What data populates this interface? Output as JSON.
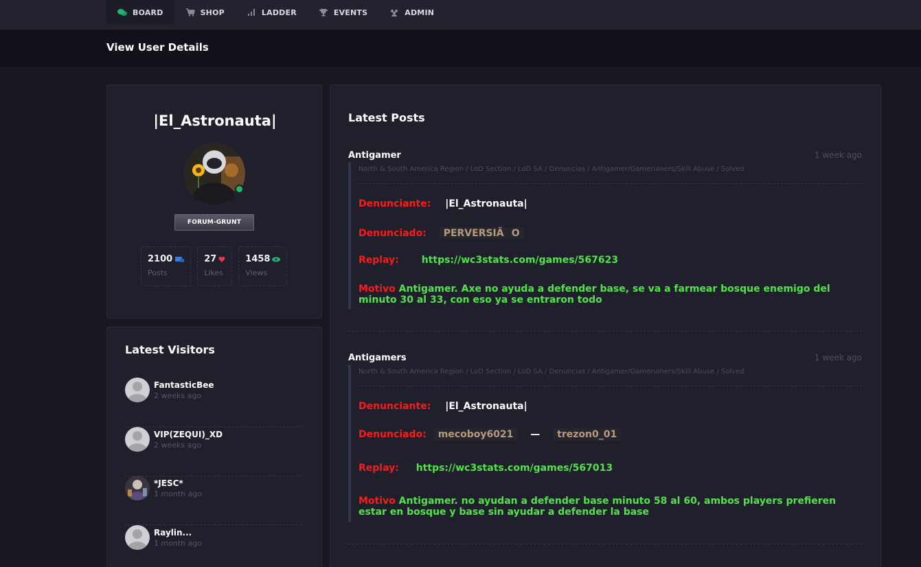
{
  "nav": {
    "items": [
      {
        "label": "BOARD",
        "icon": "chat-bubbles-icon"
      },
      {
        "label": "SHOP",
        "icon": "cart-icon"
      },
      {
        "label": "LADDER",
        "icon": "bar-chart-icon"
      },
      {
        "label": "EVENTS",
        "icon": "trophy-icon"
      },
      {
        "label": "ADMIN",
        "icon": "users-icon"
      }
    ]
  },
  "page": {
    "title": "View User Details"
  },
  "profile": {
    "username": "|El_Astronauta|",
    "rank": "FORUM-GRUNT",
    "stats": [
      {
        "value": "2100",
        "label": "Posts",
        "icon": "scroll-icon",
        "color": "#3d7bd9"
      },
      {
        "value": "27",
        "label": "Likes",
        "icon": "heart-icon",
        "color": "#e8394d"
      },
      {
        "value": "1458",
        "label": "Views",
        "icon": "eye-icon",
        "color": "#1fb86a"
      }
    ]
  },
  "visitors": {
    "title": "Latest Visitors",
    "items": [
      {
        "name": "FantasticBee",
        "time": "2 weeks ago"
      },
      {
        "name": "VIP(ZEQUI)_XD",
        "time": "2 weeks ago"
      },
      {
        "name": "*JESC*",
        "time": "1 month ago"
      },
      {
        "name": "Raylin...",
        "time": "1 month ago"
      }
    ]
  },
  "posts": {
    "title": "Latest Posts",
    "items": [
      {
        "title": "Antigamer",
        "time": "1 week ago",
        "breadcrumb": "North & South America Region / LoD Section / LoD SA / Denuncias / Antigamer/Gameruiners/Skill Abuse / Solved",
        "denunciante_label": "Denunciante:",
        "denunciante": "|El_Astronauta|",
        "denunciado_label": "Denunciado:",
        "denunciado": "PERVERSIÃO",
        "replay_label": "Replay:",
        "replay": "https://wc3stats.com/games/567623",
        "motivo_label": "Motivo",
        "motivo": "Antigamer. Axe no ayuda a defender base, se va a farmear bosque enemigo del minuto 30 al 33, con eso ya se entraron todo"
      },
      {
        "title": "Antigamers",
        "time": "1 week ago",
        "breadcrumb": "North & South America Region / LoD Section / LoD SA / Denuncias / Antigamer/Gameruiners/Skill Abuse / Solved",
        "denunciante_label": "Denunciante:",
        "denunciante": "|El_Astronauta|",
        "denunciado_label": "Denunciado:",
        "denunciado": "mecoboy6021",
        "denunciado_sep": "—",
        "denunciado_2": "trezon0_01",
        "replay_label": "Replay:",
        "replay": "https://wc3stats.com/games/567013",
        "motivo_label": "Motivo",
        "motivo": "Antigamer. no ayudan a defender base minuto 58 al 60, ambos players prefieren estar en bosque y base sin ayudar a defender la base"
      }
    ]
  }
}
